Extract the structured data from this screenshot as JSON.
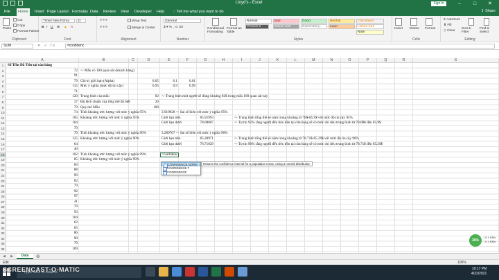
{
  "window": {
    "title": "Lloyd's - Excel",
    "signin": "Sign in",
    "share": "Share"
  },
  "tabs": [
    "File",
    "Home",
    "Insert",
    "Page Layout",
    "Formulas",
    "Data",
    "Review",
    "View",
    "Developer",
    "Help"
  ],
  "tell_me": "Tell me what you want to do",
  "ribbon": {
    "clipboard": {
      "label": "Clipboard",
      "paste": "Paste",
      "cut": "Cut",
      "copy": "Copy",
      "format_painter": "Format Painter"
    },
    "font": {
      "label": "Font",
      "name": "Times New Roma",
      "size": "11"
    },
    "alignment": {
      "label": "Alignment",
      "wrap": "Wrap Text",
      "merge": "Merge & Center"
    },
    "number": {
      "label": "Number",
      "format": "General"
    },
    "styles": {
      "label": "Styles",
      "conditional": "Conditional Formatting",
      "format_table": "Format as Table",
      "percent_style": "Percent 2",
      "cells": [
        "Normal",
        "Bad",
        "Good",
        "Neutral",
        "Calculation",
        "Check Cell",
        "Explanatory...",
        "Input",
        "Linked Cell",
        "Note"
      ]
    },
    "cells": {
      "label": "Cells",
      "insert": "Insert",
      "delete": "Delete",
      "format": "Format"
    },
    "editing": {
      "label": "Editing",
      "autosum": "AutoSum",
      "fill": "Fill",
      "clear": "Clear",
      "sort": "Sort & Filter",
      "find": "Find & Select"
    }
  },
  "formula_bar": {
    "name_box": "SUM",
    "formula": "=confidenc",
    "buttons": "✕ ✓ fx"
  },
  "columns": [
    "A",
    "B",
    "C",
    "D",
    "E",
    "F",
    "G",
    "H",
    "I",
    "J",
    "K",
    "L",
    "M",
    "N",
    "O",
    "P",
    "Q",
    "R",
    "S"
  ],
  "rows": [
    {
      "n": "1",
      "A": "Số Tiền Đã Tiêu tại cửa hàng"
    },
    {
      "n": "2",
      "A": "72",
      "B": "<- Mẫu có 100 quan sát (khách hàng)"
    },
    {
      "n": "3",
      "A": "91"
    },
    {
      "n": "4",
      "A": "79",
      "B": "Giá trị giới hạn (Alpha)",
      "D": "0.05",
      "E": "0.1",
      "F": "0.01"
    },
    {
      "n": "5",
      "A": "115",
      "B": "Mức ý nghĩa (mức độ tin cậy)",
      "D": "0.95",
      "E": "0.9",
      "F": "0.99"
    },
    {
      "n": "6",
      "A": "71"
    },
    {
      "n": "7",
      "A": "120",
      "B": "Trung bình của mẫu",
      "D": "82",
      "E": "<- Trung bình một người sẽ dùng khoảng 82$ trong mẫu 100 quan sát này"
    },
    {
      "n": "8",
      "A": "37",
      "B": "Độ lệch chuẩn của tổng thể đã biết",
      "D": "20"
    },
    {
      "n": "9",
      "A": "79",
      "B": "Quy mô Mẫu",
      "D": "100"
    },
    {
      "n": "10",
      "A": "74",
      "B": "Tính khoảng ước lượng với mức ý nghĩa 95%",
      "E": "3.919928 <- Sai số biên với mức ý nghĩa 95%"
    },
    {
      "n": "11",
      "A": "105",
      "B": "Khoảng ước lượng với mức ý nghĩa 95%",
      "E": "Giới hạn trên",
      "G": "85.91993",
      "I": "<- Trung bình tổng thể sẽ nằm trong khoảng từ 78$-85.9$ với mức độ tin cậy 95%"
    },
    {
      "n": "12",
      "A": "104",
      "E": "Giới hạn dưới",
      "G": "78.08007",
      "I": "<- Tự tin 95% rằng người đến tiêu tiền tại cửa hàng sẽ có mức chi tiêu trung bình từ 78.08$ đến 85.9$"
    },
    {
      "n": "13",
      "A": "79"
    },
    {
      "n": "14",
      "A": "70",
      "B": "Tính khoảng ước lượng với mức ý nghĩa 90%",
      "E": "3.289707 <- Sai số biên với mức ý nghĩa 90%"
    },
    {
      "n": "15",
      "A": "125",
      "B": "Khoảng ước lượng với mức ý nghĩa 90%",
      "E": "Giới hạn trên",
      "G": "85.28971",
      "I": "<- Trung bình tổng thể sẽ nằm trong khoảng từ 78.71$-85.29$ với mức độ tin cậy 90%"
    },
    {
      "n": "16",
      "A": "64",
      "E": "Giới hạn dưới",
      "G": "78.71029",
      "I": "<- Tự tin 90% rằng người đến tiêu tiền tại cửa hàng sẽ có mức chi tiêu trung bình từ 78.71$ đến 85.29$"
    },
    {
      "n": "17",
      "A": "40"
    },
    {
      "n": "18",
      "A": "102",
      "B": "Tính khoảng ước lượng với mức ý nghĩa 99%",
      "E": "=confidenc"
    },
    {
      "n": "19",
      "A": "85",
      "B": "Khoảng ước lượng với mức ý nghĩa 99%"
    },
    {
      "n": "20",
      "A": "60"
    },
    {
      "n": "21",
      "A": "88"
    },
    {
      "n": "22",
      "A": "90"
    },
    {
      "n": "23",
      "A": "82"
    },
    {
      "n": "24",
      "A": "79"
    },
    {
      "n": "25",
      "A": "92"
    },
    {
      "n": "26",
      "A": "97"
    },
    {
      "n": "27",
      "A": "41"
    },
    {
      "n": "28",
      "A": "70"
    },
    {
      "n": "29",
      "A": "93"
    },
    {
      "n": "30",
      "A": "104"
    },
    {
      "n": "31",
      "A": "62"
    },
    {
      "n": "32",
      "A": "65"
    },
    {
      "n": "33",
      "A": "86"
    },
    {
      "n": "34",
      "A": "90"
    },
    {
      "n": "35",
      "A": "79"
    },
    {
      "n": "36",
      "A": "109"
    }
  ],
  "autocomplete": {
    "items": [
      "CONFIDENCE.NORM",
      "CONFIDENCE.T",
      "CONFIDENCE"
    ],
    "tooltip": "Returns the confidence interval for a population mean, using a normal distribution"
  },
  "sheet_tabs": [
    "Data"
  ],
  "status": {
    "mode": "Edit",
    "zoom": "100%"
  },
  "taskbar": {
    "search_placeholder": "Type here to search",
    "time": "10:17 PM",
    "date": "4/22/2021",
    "watermark": "SCREENCAST-O-MATIC"
  },
  "badge": {
    "value": "36%",
    "up": "0.1 KB/s",
    "down": "0.1 KB/s"
  },
  "colors": {
    "excel_green": "#217346",
    "selection": "#cde6f7",
    "badge": "#4caf50"
  }
}
